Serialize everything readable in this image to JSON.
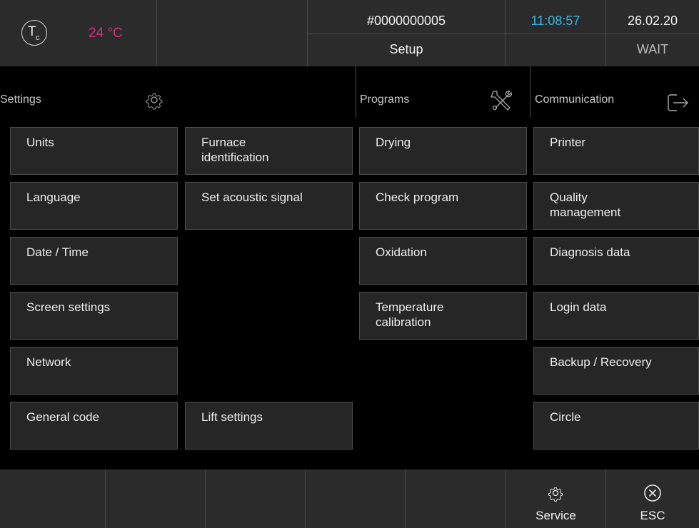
{
  "header": {
    "temp_symbol": "T",
    "temp_sub": "c",
    "temperature": "24 °C",
    "order_number": "#0000000005",
    "time": "11:08:57",
    "date": "26.02.20",
    "menu_title": "Setup",
    "status": "WAIT"
  },
  "sections": {
    "settings": "Settings",
    "programs": "Programs",
    "communication": "Communication"
  },
  "settings_col1": [
    "Units",
    "Language",
    "Date / Time",
    "Screen settings",
    "Network",
    "General code"
  ],
  "settings_col2": [
    "Furnace identification",
    "Set acoustic signal",
    "Lift settings"
  ],
  "programs": [
    "Drying",
    "Check program",
    "Oxidation",
    "Temperature calibration"
  ],
  "communication": [
    "Printer",
    "Quality management",
    "Diagnosis data",
    "Login data",
    "Backup / Recovery",
    "Circle"
  ],
  "footer": {
    "service": "Service",
    "esc": "ESC"
  },
  "colors": {
    "temperature": "#d9307a",
    "time": "#39b5ea",
    "panel": "#2b2b2b",
    "button": "#262626"
  },
  "icons": [
    "thermocouple-icon",
    "gear-icon",
    "tools-icon",
    "exit-icon",
    "close-circle-icon"
  ]
}
